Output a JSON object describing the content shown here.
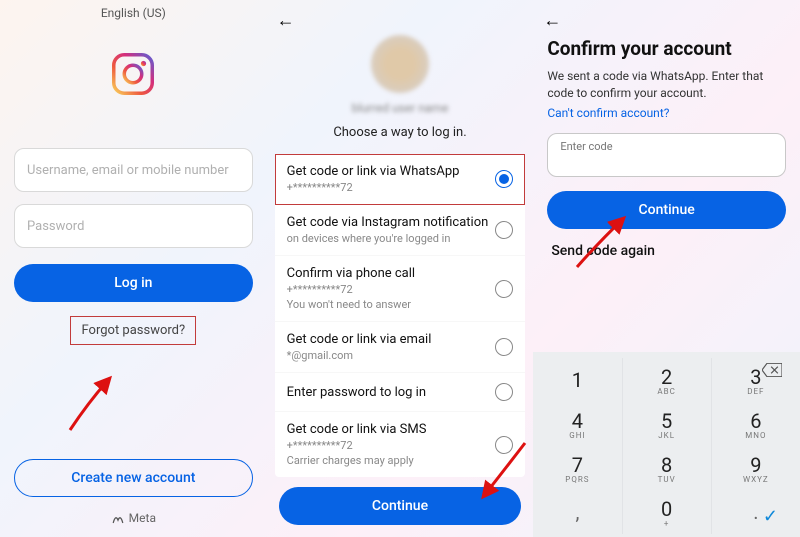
{
  "panel1": {
    "language": "English (US)",
    "username_ph": "Username, email or mobile number",
    "password_ph": "Password",
    "login_btn": "Log in",
    "forgot": "Forgot password?",
    "create_btn": "Create new account",
    "meta": "Meta"
  },
  "panel2": {
    "blurred_name": "blurred user name",
    "subtitle": "Choose a way to log in.",
    "options": [
      {
        "title": "Get code or link via WhatsApp",
        "sub": "+**********72",
        "selected": true,
        "highlight": true
      },
      {
        "title": "Get code via Instagram notification",
        "sub": "on devices where you're logged in",
        "selected": false
      },
      {
        "title": "Confirm via phone call",
        "sub": "+**********72\nYou won't need to answer",
        "selected": false
      },
      {
        "title": "Get code or link via email",
        "sub": "*@gmail.com",
        "selected": false
      },
      {
        "title": "Enter password to log in",
        "sub": "",
        "selected": false
      },
      {
        "title": "Get code or link via SMS",
        "sub": "+**********72\nCarrier charges may apply",
        "selected": false
      }
    ],
    "continue_btn": "Continue"
  },
  "panel3": {
    "title": "Confirm your account",
    "desc": "We sent a code via WhatsApp. Enter that code to confirm your account.",
    "link": "Can't confirm account?",
    "code_label": "Enter code",
    "continue_btn": "Continue",
    "send_again": "Send code again",
    "keypad": {
      "rows": [
        [
          {
            "d": "1",
            "l": ""
          },
          {
            "d": "2",
            "l": "ABC"
          },
          {
            "d": "3",
            "l": "DEF"
          }
        ],
        [
          {
            "d": "4",
            "l": "GHI"
          },
          {
            "d": "5",
            "l": "JKL"
          },
          {
            "d": "6",
            "l": "MNO"
          }
        ],
        [
          {
            "d": "7",
            "l": "PQRS"
          },
          {
            "d": "8",
            "l": "TUV"
          },
          {
            "d": "9",
            "l": "WXYZ"
          }
        ],
        [
          {
            "d": ",",
            "l": "",
            "util": true
          },
          {
            "d": "0",
            "l": "+"
          },
          {
            "d": ".",
            "l": "",
            "util": true
          }
        ]
      ]
    }
  }
}
